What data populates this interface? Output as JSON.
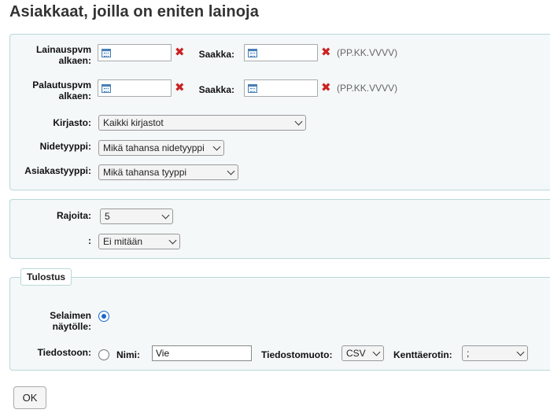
{
  "page": {
    "title": "Asiakkaat, joilla on eniten lainoja"
  },
  "filters": {
    "loan_date_label_1": "Lainauspvm",
    "loan_date_label_2": "alkaen:",
    "loan_to_label": "Saakka:",
    "return_date_label_1": "Palautuspvm",
    "return_date_label_2": "alkaen:",
    "return_to_label": "Saakka:",
    "clear_symbol": "✖",
    "date_format_hint": "(PP.KK.VVVV)",
    "library_label": "Kirjasto:",
    "library_value": "Kaikki kirjastot",
    "itemtype_label": "Nidetyyppi:",
    "itemtype_value": "Mikä tahansa nidetyyppi",
    "patrontype_label": "Asiakastyyppi:",
    "patrontype_value": "Mikä tahansa tyyppi"
  },
  "limits": {
    "limit_label": "Rajoita:",
    "limit_value": "5",
    "by_label": ":",
    "by_value": "Ei mitään"
  },
  "output": {
    "legend": "Tulostus",
    "browser_label_1": "Selaimen",
    "browser_label_2": "näytölle:",
    "file_label": "Tiedostoon:",
    "name_label": "Nimi:",
    "name_value": "Vie",
    "format_label": "Tiedostomuoto:",
    "format_value": "CSV",
    "delimiter_label": "Kenttäerotin:",
    "delimiter_value": ";"
  },
  "actions": {
    "ok_label": "OK"
  },
  "colors": {
    "fieldset_bg": "#f4f8f9",
    "fieldset_border": "#b9d8d9",
    "clear_red": "#cc2222",
    "radio_blue": "#1a66cc"
  }
}
